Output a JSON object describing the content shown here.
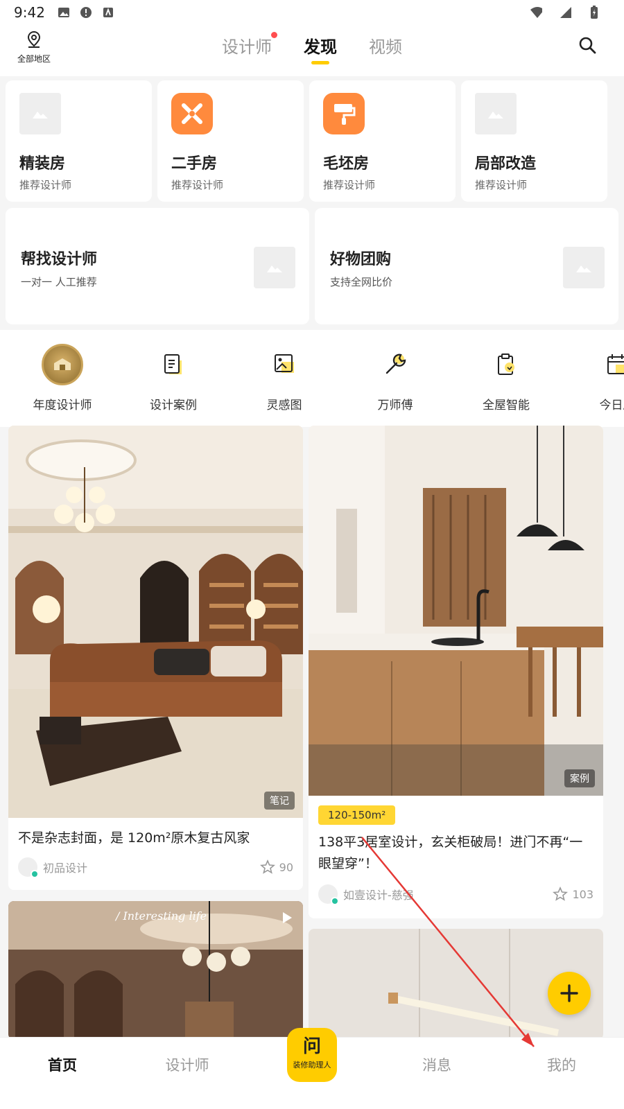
{
  "status": {
    "time": "9:42"
  },
  "header": {
    "location": "全部地区",
    "tabs": [
      "设计师",
      "发现",
      "视频"
    ]
  },
  "categories": [
    {
      "title": "精装房",
      "sub": "推荐设计师"
    },
    {
      "title": "二手房",
      "sub": "推荐设计师"
    },
    {
      "title": "毛坯房",
      "sub": "推荐设计师"
    },
    {
      "title": "局部改造",
      "sub": "推荐设计师"
    }
  ],
  "wide": [
    {
      "title": "帮找设计师",
      "sub": "一对一 人工推荐"
    },
    {
      "title": "好物团购",
      "sub": "支持全网比价"
    }
  ],
  "quick": [
    "年度设计师",
    "设计案例",
    "灵感图",
    "万师傅",
    "全屋智能",
    "今日局"
  ],
  "feed": {
    "left1": {
      "badge": "笔记",
      "title": "不是杂志封面，是 120m²原木复古风家",
      "author": "初品设计",
      "likes": "90"
    },
    "right1": {
      "badge": "案例",
      "tag": "120-150m²",
      "title": "138平3居室设计，玄关柜破局！进门不再“一眼望穿”！",
      "author": "如壹设计-慈强",
      "likes": "103"
    },
    "left2": {
      "overlay": "/ Interesting life"
    }
  },
  "bottom_nav": [
    "首页",
    "设计师",
    "消息",
    "我的"
  ],
  "assistant": {
    "big": "问",
    "small": "装修助理人"
  },
  "colors": {
    "accent": "#ffcc00",
    "orange": "#ff8a3d"
  }
}
